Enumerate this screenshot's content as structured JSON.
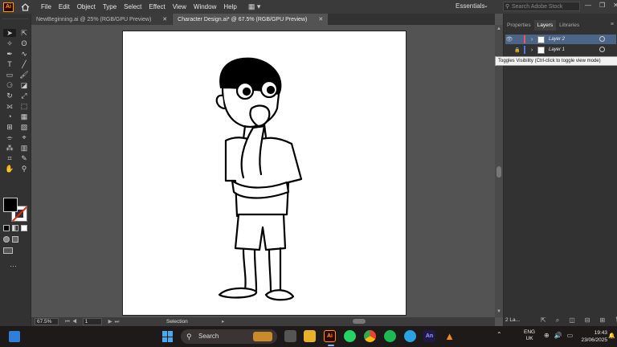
{
  "app": {
    "logo_text": "Ai",
    "menus": [
      "File",
      "Edit",
      "Object",
      "Type",
      "Select",
      "Effect",
      "View",
      "Window",
      "Help"
    ],
    "workspace": "Essentials",
    "stock_search_placeholder": "Search Adobe Stock"
  },
  "tabs": [
    {
      "label": "NewBeginning.ai @ 25% (RGB/GPU Preview)",
      "active": false
    },
    {
      "label": "Character Design.ai* @ 67.5% (RGB/GPU Preview)",
      "active": true
    }
  ],
  "status": {
    "zoom": "67.5%",
    "artboard_number": "1",
    "tool_label": "Selection"
  },
  "panel": {
    "tabs": [
      "Properties",
      "Layers",
      "Libraries"
    ],
    "active_tab": "Layers",
    "layers": [
      {
        "name": "Layer 2",
        "color": "#e65c5c",
        "selected": true
      },
      {
        "name": "Layer 1",
        "color": "#4a7bd8",
        "selected": false
      }
    ],
    "tooltip": "Toggles Visibility (Ctrl-click to toggle view mode)",
    "footer_count": "2 La..."
  },
  "taskbar": {
    "search_label": "Search",
    "lang_top": "ENG",
    "lang_bottom": "UK",
    "time": "19:43",
    "date": "23/06/2025"
  },
  "colors": {
    "accent_selected_layer": "#4b6487",
    "illustrator_orange": "#ff9a00"
  }
}
